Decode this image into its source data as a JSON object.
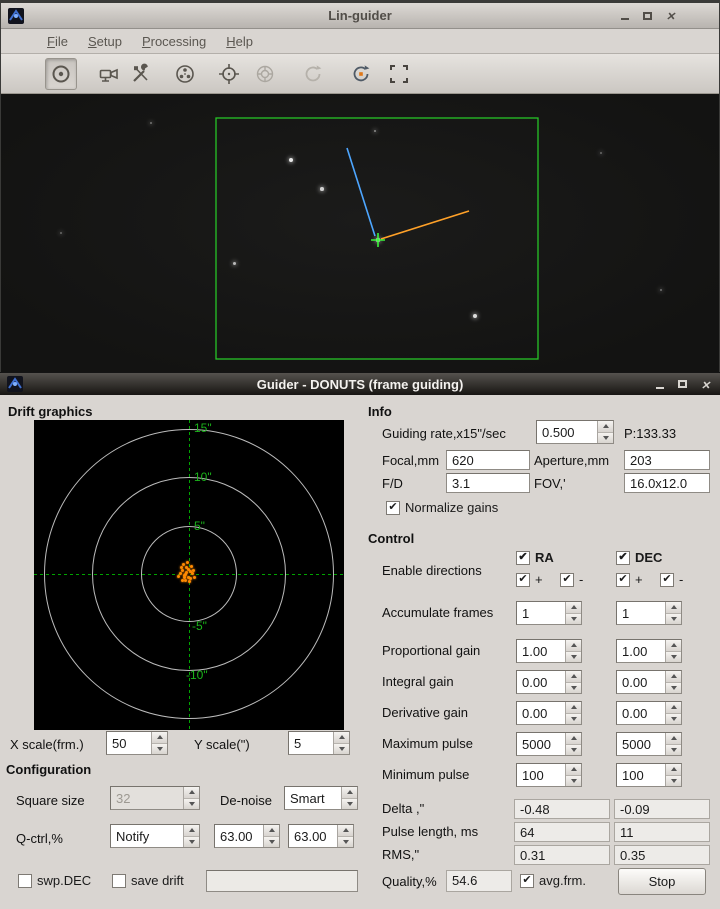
{
  "linguider": {
    "title": "Lin-guider",
    "menu": [
      "File",
      "Setup",
      "Processing",
      "Help"
    ],
    "toolbar_icons": [
      "exposure",
      "camera",
      "setup-tools",
      "video-record",
      "reticle",
      "guide-target",
      "refresh",
      "calibration",
      "subframe"
    ],
    "overlay_colors": {
      "selection": "#27c427",
      "ray_blue": "#4da6ff",
      "ray_orange": "#ffa128",
      "crosshair": "#39f539"
    },
    "stars": [
      [
        290,
        66,
        2.2,
        0.9
      ],
      [
        321,
        95,
        1.8,
        0.8
      ],
      [
        233,
        169,
        1.5,
        0.7
      ],
      [
        474,
        222,
        2.2,
        0.85
      ],
      [
        374,
        37,
        1.3,
        0.5
      ],
      [
        660,
        196,
        1.2,
        0.4
      ],
      [
        150,
        29,
        1.2,
        0.4
      ],
      [
        60,
        139,
        1.0,
        0.35
      ],
      [
        600,
        59,
        1.0,
        0.35
      ],
      [
        377,
        146,
        2.4,
        0.95
      ]
    ]
  },
  "guider": {
    "title": "Guider - DONUTS (frame guiding)",
    "drift": {
      "section_label": "Drift graphics",
      "ring_labels": [
        "15\"",
        "10\"",
        "5\"",
        "-5\"",
        "-10\""
      ],
      "label_color": "#1ab21a",
      "scatter_color": "#ff8a00",
      "x_scale_label": "X scale(frm.)",
      "x_scale_value": "50",
      "y_scale_label": "Y scale(\")",
      "y_scale_value": "5",
      "scatter": [
        [
          148,
          150
        ],
        [
          152,
          147
        ],
        [
          156,
          151
        ],
        [
          150,
          155
        ],
        [
          154,
          157
        ],
        [
          158,
          153
        ],
        [
          146,
          153
        ],
        [
          151,
          160
        ],
        [
          155,
          161
        ],
        [
          149,
          144
        ],
        [
          157,
          146
        ],
        [
          160,
          157
        ],
        [
          144,
          156
        ],
        [
          152,
          152
        ],
        [
          156,
          158
        ],
        [
          148,
          160
        ],
        [
          153,
          142
        ],
        [
          159,
          150
        ],
        [
          147,
          147
        ],
        [
          150,
          157
        ],
        [
          154,
          149
        ],
        [
          151,
          154
        ]
      ]
    },
    "configuration": {
      "section_label": "Configuration",
      "square_size_label": "Square size",
      "square_size_value": "32",
      "denoise_label": "De-noise",
      "denoise_value": "Smart",
      "qctrl_label": "Q-ctrl,%",
      "qctrl_value": "Notify",
      "qctrl_ra": "63.00",
      "qctrl_dec": "63.00",
      "swp_dec_label": "swp.DEC",
      "save_drift_label": "save drift",
      "drift_file_value": ""
    },
    "info": {
      "section_label": "Info",
      "guiding_rate_label": "Guiding rate,x15\"/sec",
      "guiding_rate_value": "0.500",
      "p_value": "P:133.33",
      "focal_label": "Focal,mm",
      "focal_value": "620",
      "aperture_label": "Aperture,mm",
      "aperture_value": "203",
      "fd_label": "F/D",
      "fd_value": "3.1",
      "fov_label": "FOV,'",
      "fov_value": "16.0x12.0",
      "normalize_label": "Normalize gains"
    },
    "control": {
      "section_label": "Control",
      "enable_label": "Enable directions",
      "ra_label": "RA",
      "dec_label": "DEC",
      "plus": "+",
      "minus": "-",
      "gain_rows": [
        {
          "label": "Accumulate frames",
          "ra": "1",
          "dec": "1"
        },
        {
          "label": "Proportional gain",
          "ra": "1.00",
          "dec": "1.00"
        },
        {
          "label": "Integral gain",
          "ra": "0.00",
          "dec": "0.00"
        },
        {
          "label": "Derivative gain",
          "ra": "0.00",
          "dec": "0.00"
        },
        {
          "label": "Maximum pulse",
          "ra": "5000",
          "dec": "5000"
        },
        {
          "label": "Minimum pulse",
          "ra": "100",
          "dec": "100"
        }
      ],
      "readout_rows": [
        {
          "label": "Delta ,\"",
          "ra": "-0.48",
          "dec": "-0.09"
        },
        {
          "label": "Pulse length, ms",
          "ra": "64",
          "dec": "11"
        },
        {
          "label": "RMS,\"",
          "ra": "0.31",
          "dec": "0.35"
        }
      ],
      "quality_label": "Quality,%",
      "quality_value": "54.6",
      "avg_frm_label": "avg.frm.",
      "stop_label": "Stop"
    }
  }
}
